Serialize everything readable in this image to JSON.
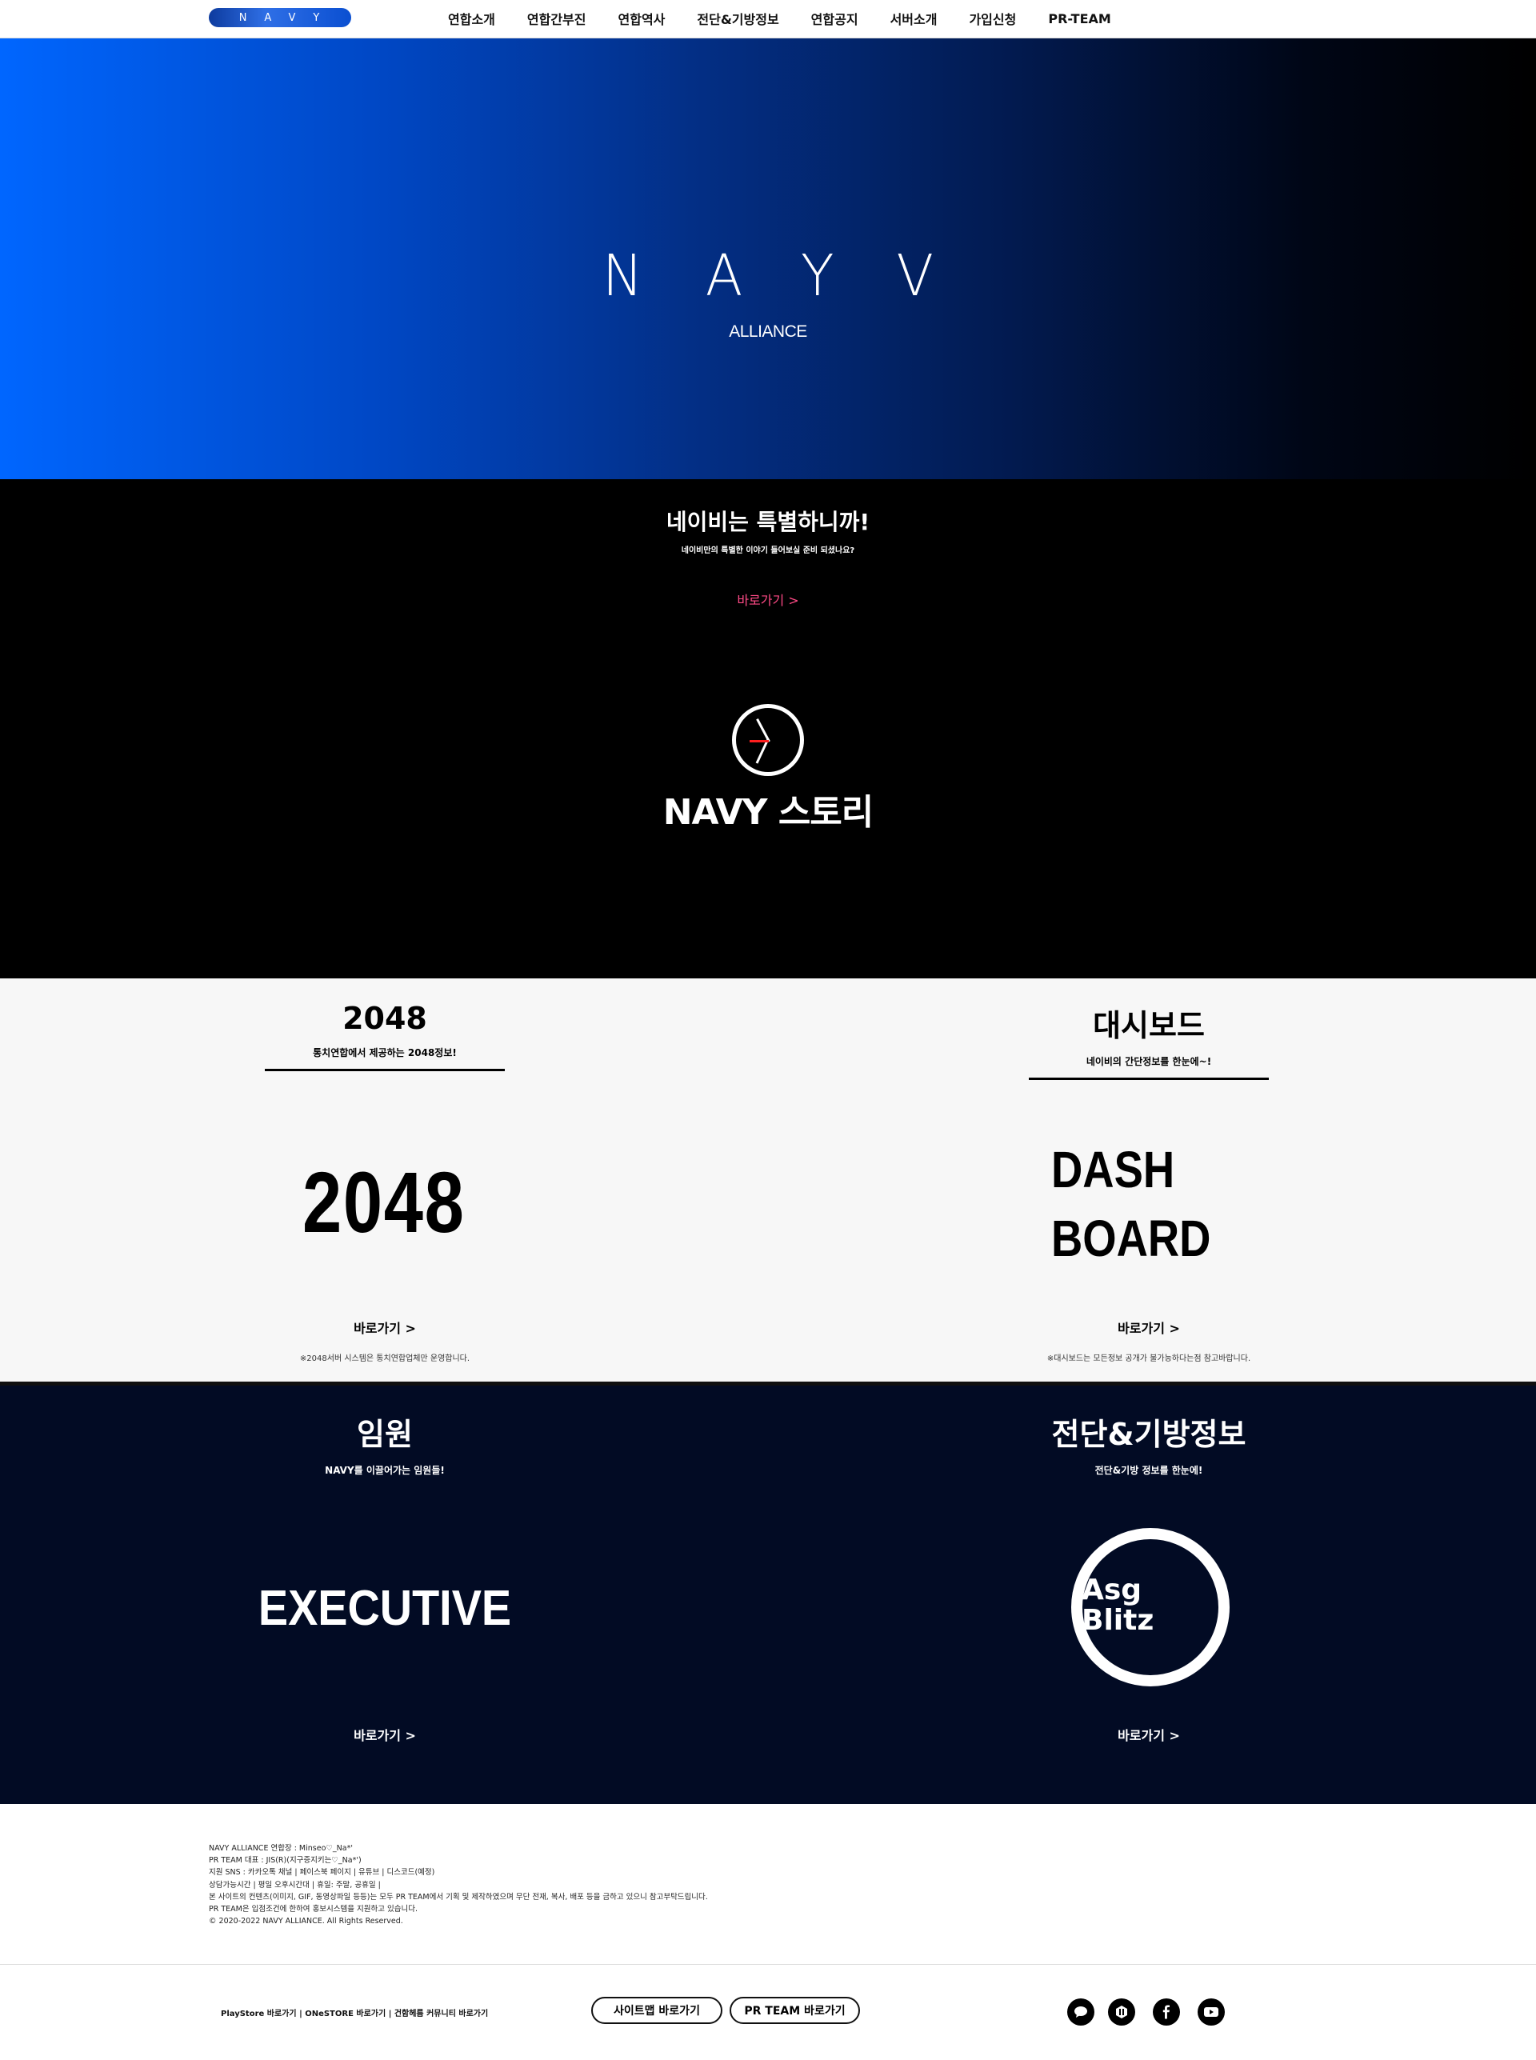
{
  "header": {
    "logo_text": "NAVY",
    "nav": [
      "연합소개",
      "연합간부진",
      "연합역사",
      "전단&기방정보",
      "연합공지",
      "서버소개",
      "가입신청",
      "PR-TEAM"
    ]
  },
  "hero": {
    "title": "NAYV",
    "subtitle": "ALLIANCE"
  },
  "story": {
    "title": "네이비는 특별하니까!",
    "desc": "네이비만의 특별한 이야기 들어보실 준비 되셨나요?",
    "link": "바로가기  >",
    "brand": "NAVY 스토리"
  },
  "sections_light": {
    "left": {
      "title": "2048",
      "desc": "통치연합에서 제공하는 2048정보!",
      "big": "2048",
      "link": "바로가기  >",
      "note": "※2048서버 시스템은 통치연합업체만 운영합니다."
    },
    "right": {
      "title": "대시보드",
      "desc": "네이비의 간단정보를 한눈에~!",
      "big_line1": "DASH",
      "big_line2": "BOARD",
      "link": "바로가기  >",
      "note": "※대시보드는 모든정보 공개가 불가능하다는점 참고바랍니다."
    }
  },
  "sections_dark": {
    "left": {
      "title": "임원",
      "desc": "NAVY를 이끌어가는 임원들!",
      "big": "EXECUTIVE",
      "link": "바로가기  >"
    },
    "right": {
      "title": "전단&기방정보",
      "desc": "전단&기방 정보를 한눈에!",
      "ring_line1": "Asg",
      "ring_line2": "Blitz",
      "link": "바로가기  >"
    }
  },
  "info": {
    "lines": [
      "NAVY ALLIANCE 연합장 : Minseo♡_Na*'",
      "PR TEAM 대표 : JIS(R)(지구증지키는♡_Na*')",
      "지원 SNS : 카카오톡 채널  |  페이스북 페이지  |  유튜브  |  디스코드(예정)",
      "상담가능시간  |  평일 오후시간대  |  휴일: 주말, 공휴일  |",
      "본 사이트의 컨텐츠(이미지, GIF, 동영상파일 등등)는 모두 PR TEAM에서 기획 및 제작하였으며 무단 전재, 복사, 배포 등을 금하고 있으니 참고부탁드립니다.",
      "PR TEAM은 입점조건에 한하여 홍보시스템을 지원하고 있습니다.",
      "© 2020-2022 NAVY ALLIANCE. All Rights Reserved."
    ]
  },
  "bottom": {
    "links": [
      "PlayStore 바로가기",
      "ONeSTORE 바로가기",
      "건함헤름 커뮤니티 바로가기"
    ],
    "pill1": "사이트맵 바로가기",
    "pill2": "PR TEAM 바로가기",
    "social_icons": [
      "talk-icon",
      "community-icon",
      "facebook-icon",
      "youtube-icon"
    ]
  }
}
